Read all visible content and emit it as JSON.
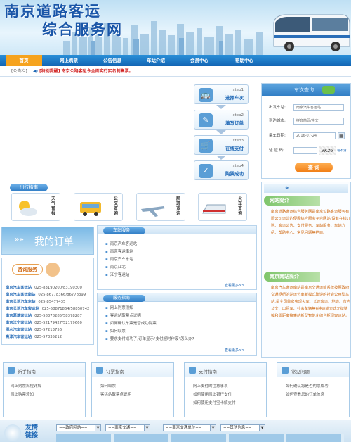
{
  "header": {
    "title_line1": "南京道路客运",
    "title_line2": "综合服务网"
  },
  "nav": {
    "items": [
      "首页",
      "网上购票",
      "公告信息",
      "车站介绍",
      "会员中心",
      "帮助中心"
    ]
  },
  "notice": {
    "label": "[公告栏]",
    "text": "[特别提醒] 南京公路客运今全面实行实名制售票。"
  },
  "steps": [
    {
      "step": "step1",
      "name": "选择车次"
    },
    {
      "step": "step2",
      "name": "填写订单"
    },
    {
      "step": "step3",
      "name": "在线支付"
    },
    {
      "step": "step4",
      "name": "购票成功"
    }
  ],
  "query": {
    "station_label": "出发车站:",
    "station_value": "南京汽车客运站",
    "city_label": "到达城市:",
    "city_placeholder": "拼音简码/中文",
    "date_label": "乘车日期:",
    "date_value": "2016-07-24",
    "code_label": "验 证 码:",
    "code_value": "9Kz6",
    "code_hint": "看不清",
    "submit": "查 询"
  },
  "travel": {
    "title": "出行指南",
    "items": [
      {
        "label": "天气预报",
        "icon": "weather-icon"
      },
      {
        "label": "公交查询",
        "icon": "bus-icon"
      },
      {
        "label": "航班查询",
        "icon": "plane-icon"
      },
      {
        "label": "火车查询",
        "icon": "train-icon"
      }
    ]
  },
  "my_order": {
    "title": "我的订单",
    "consult_title": "咨询服务"
  },
  "contacts": [
    {
      "name": "南京汽车客运站",
      "phone": "025-83190200/83190300"
    },
    {
      "name": "南京汽车客运南站",
      "phone": "025-86778366/86778399"
    },
    {
      "name": "南京长途汽车东站",
      "phone": "025-85477435"
    },
    {
      "name": "南京长途汽车客运站",
      "phone": "025-58871864/58850742"
    },
    {
      "name": "南京葛塘客运站",
      "phone": "025-58378285/58378287"
    },
    {
      "name": "南京江宁客运站",
      "phone": "025-52179427/52179660"
    },
    {
      "name": "溧水汽车客运站",
      "phone": "025-57213756"
    },
    {
      "name": "高淳汽车客运站",
      "phone": "025-57335212"
    }
  ],
  "station_service": {
    "title": "车站服务",
    "items": [
      "南京汽车客运站",
      "南京客运南站",
      "南京汽车东站",
      "南京江北",
      "江宁客运站"
    ],
    "more": "查看更多>>"
  },
  "service_guide": {
    "title": "服务指南",
    "items": [
      "网上购票须知",
      "客运站取票点说明",
      "如何确认车票是否成功购票",
      "如何取票",
      "要求支付成功了,订单显示\"支付超时作废\"怎么办?"
    ],
    "more": "查看更多>>"
  },
  "side": {
    "login_title": "车次查询",
    "intro_title": "网站简介",
    "intro_text": "南京道路客运综合服务网是南京公路客运服务有限公司运营的便民综合服务平台网站,设有在线订购、客运公告、支付服务、车站服务、车站介绍、帮助中心、常见问题等栏目。",
    "south_title": "南京南站简介",
    "south_text": "南京汽车客运南站是南京交通运输系统按照政府交通枢纽的站运分离新模式建设的社会公用型车站,是全国首家实现火车、长途客运、地铁、市内公交、出租车、社会车辆等6种运输方式无缝链接和零距离换乘的新型智能化综合枢纽客运站。"
  },
  "bottom_boxes": [
    {
      "title": "新手指南",
      "items": [
        "网上购票流程详解",
        "网上购票须知"
      ]
    },
    {
      "title": "订票指南",
      "items": [
        "如何取票",
        "客运站取票点说明"
      ]
    },
    {
      "title": "支付指南",
      "items": [
        "网上支付的注意事项",
        "如何使用网上银行支付",
        "如何使用支付宝卡解支付"
      ]
    },
    {
      "title": "常见问题",
      "items": [
        "如何确认您是否购票成功",
        "如何查看您的订单信息"
      ]
    }
  ],
  "friend_links": {
    "label": "友情链接",
    "selects": [
      "==政府网站==",
      "==南京交通==",
      "==南京交通单位==",
      "==其他信息=="
    ]
  },
  "colors": {
    "nav": "#1b78c8",
    "accent": "#f6a31e",
    "link": "#1c66b5"
  }
}
